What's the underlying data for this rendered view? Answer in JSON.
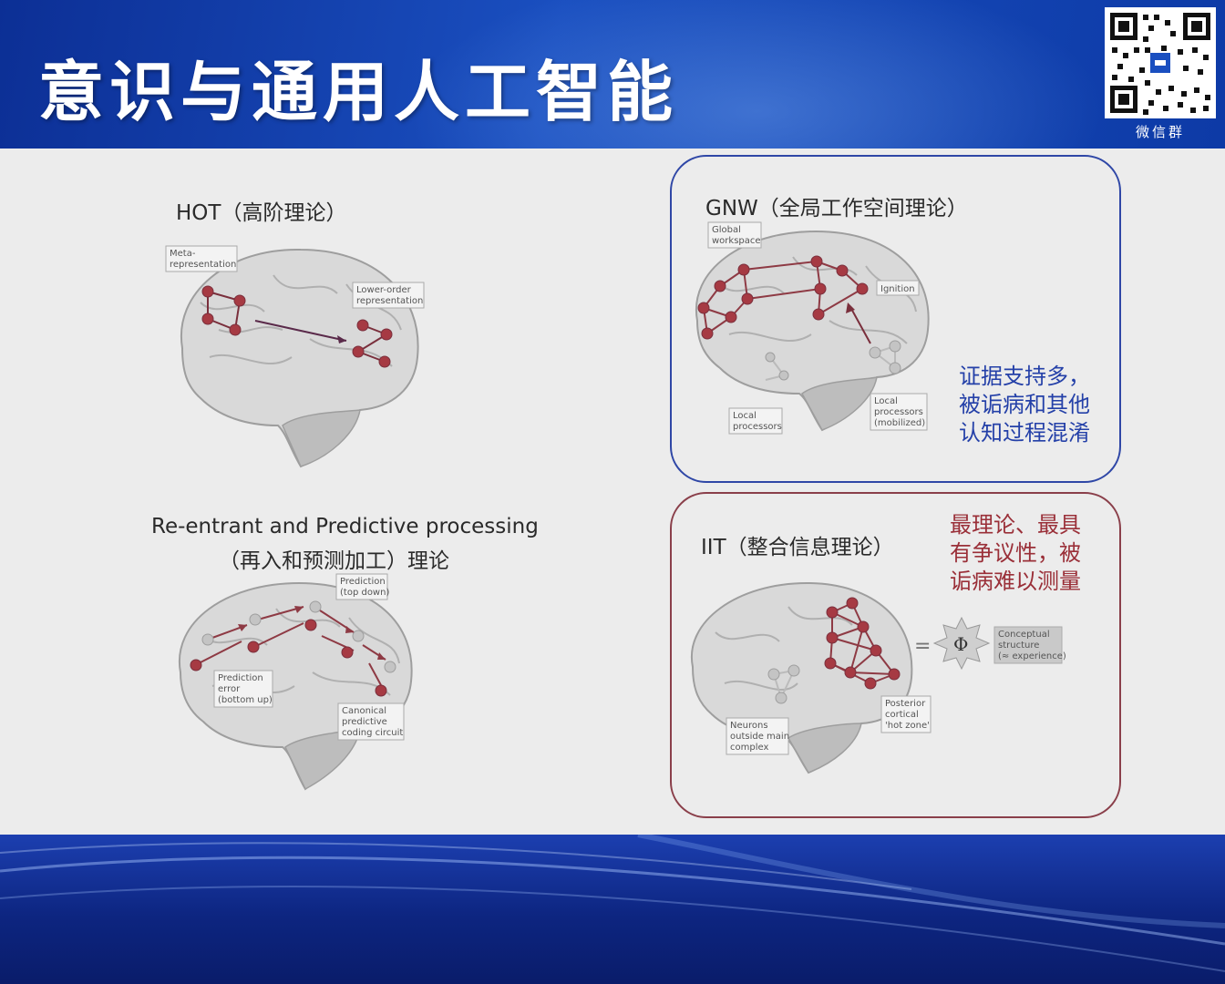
{
  "slide": {
    "title": "意识与通用人工智能",
    "qr_caption": "微信群"
  },
  "panels": {
    "hot": {
      "title": "HOT（高阶理论）",
      "labels": [
        "Meta-",
        "representation",
        "Lower-order",
        "representation"
      ]
    },
    "gnw": {
      "title": "GNW（全局工作空间理论）",
      "labels": [
        "Global",
        "workspace",
        "Ignition",
        "Local",
        "processors",
        "Local",
        "processors",
        "(mobilized)"
      ],
      "note_lines": [
        "证据支持多，",
        "被诟病和其他",
        "认知过程混淆"
      ]
    },
    "rpp": {
      "title_line1": "Re-entrant and Predictive processing",
      "title_line2": "（再入和预测加工）理论",
      "labels": [
        "Prediction",
        "(top down)",
        "Prediction",
        "error",
        "(bottom up)",
        "Canonical",
        "predictive",
        "coding circuit"
      ]
    },
    "iit": {
      "title": "IIT（整合信息理论）",
      "labels": [
        "Conceptual",
        "structure",
        "(≈ experience)",
        "Posterior",
        "cortical",
        "'hot zone'",
        "Neurons",
        "outside main",
        "complex",
        "Φ"
      ],
      "note_lines": [
        "最理论、最具",
        "有争议性，被",
        "诟病难以测量"
      ]
    }
  },
  "colors": {
    "header_blue": "#1a4fc0",
    "node_red": "#a63a43",
    "gnw_border": "#2f47a6",
    "iit_border": "#8a3f4a"
  }
}
